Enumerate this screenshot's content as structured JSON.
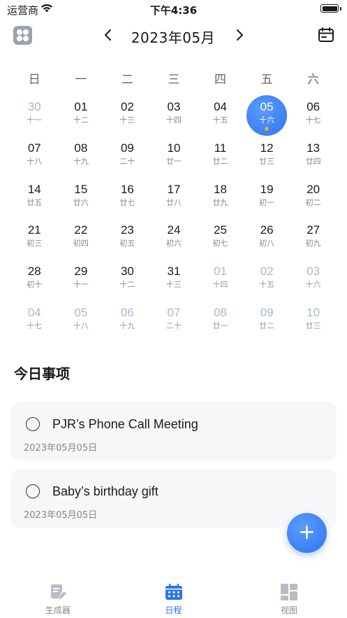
{
  "status_bar": {
    "carrier": "运营商",
    "time": "下午4:36"
  },
  "header": {
    "prev_icon": "chevron-left-icon",
    "next_icon": "chevron-right-icon",
    "month_title": "2023年05月",
    "calendar_icon": "calendar-icon"
  },
  "weekdays": [
    "日",
    "一",
    "二",
    "三",
    "四",
    "五",
    "六"
  ],
  "calendar": {
    "selected_day": "05",
    "days": [
      {
        "num": "30",
        "lunar": "十一",
        "other": true
      },
      {
        "num": "01",
        "lunar": "十二",
        "other": false
      },
      {
        "num": "02",
        "lunar": "十三",
        "other": false
      },
      {
        "num": "03",
        "lunar": "十四",
        "other": false
      },
      {
        "num": "04",
        "lunar": "十五",
        "other": false
      },
      {
        "num": "05",
        "lunar": "十六",
        "other": false,
        "selected": true,
        "has_event": true
      },
      {
        "num": "06",
        "lunar": "十七",
        "other": false
      },
      {
        "num": "07",
        "lunar": "十八",
        "other": false
      },
      {
        "num": "08",
        "lunar": "十九",
        "other": false
      },
      {
        "num": "09",
        "lunar": "二十",
        "other": false
      },
      {
        "num": "10",
        "lunar": "廿一",
        "other": false
      },
      {
        "num": "11",
        "lunar": "廿二",
        "other": false
      },
      {
        "num": "12",
        "lunar": "廿三",
        "other": false
      },
      {
        "num": "13",
        "lunar": "廿四",
        "other": false
      },
      {
        "num": "14",
        "lunar": "廿五",
        "other": false
      },
      {
        "num": "15",
        "lunar": "廿六",
        "other": false
      },
      {
        "num": "16",
        "lunar": "廿七",
        "other": false
      },
      {
        "num": "17",
        "lunar": "廿八",
        "other": false
      },
      {
        "num": "18",
        "lunar": "廿九",
        "other": false
      },
      {
        "num": "19",
        "lunar": "初一",
        "other": false
      },
      {
        "num": "20",
        "lunar": "初二",
        "other": false
      },
      {
        "num": "21",
        "lunar": "初三",
        "other": false
      },
      {
        "num": "22",
        "lunar": "初四",
        "other": false
      },
      {
        "num": "23",
        "lunar": "初五",
        "other": false
      },
      {
        "num": "24",
        "lunar": "初六",
        "other": false
      },
      {
        "num": "25",
        "lunar": "初七",
        "other": false
      },
      {
        "num": "26",
        "lunar": "初八",
        "other": false
      },
      {
        "num": "27",
        "lunar": "初九",
        "other": false
      },
      {
        "num": "28",
        "lunar": "初十",
        "other": false
      },
      {
        "num": "29",
        "lunar": "十一",
        "other": false
      },
      {
        "num": "30",
        "lunar": "十二",
        "other": false
      },
      {
        "num": "31",
        "lunar": "十三",
        "other": false
      },
      {
        "num": "01",
        "lunar": "十四",
        "other": true
      },
      {
        "num": "02",
        "lunar": "十五",
        "other": true
      },
      {
        "num": "03",
        "lunar": "十六",
        "other": true
      },
      {
        "num": "04",
        "lunar": "十七",
        "other": true
      },
      {
        "num": "05",
        "lunar": "十八",
        "other": true
      },
      {
        "num": "06",
        "lunar": "十九",
        "other": true
      },
      {
        "num": "07",
        "lunar": "二十",
        "other": true
      },
      {
        "num": "08",
        "lunar": "廿一",
        "other": true
      },
      {
        "num": "09",
        "lunar": "廿二",
        "other": true
      },
      {
        "num": "10",
        "lunar": "廿三",
        "other": true
      }
    ]
  },
  "today": {
    "title": "今日事项",
    "tasks": [
      {
        "title": "PJR’s Phone Call Meeting",
        "date": "2023年05月05日",
        "done": false
      },
      {
        "title": "Baby’s birthday gift",
        "date": "2023年05月05日",
        "done": false
      }
    ]
  },
  "fab": {
    "label": "+",
    "icon": "add-icon"
  },
  "tabbar": {
    "tabs": [
      {
        "label": "生成器",
        "icon": "document-edit-icon",
        "active": false
      },
      {
        "label": "日程",
        "icon": "calendar-icon",
        "active": true
      },
      {
        "label": "视图",
        "icon": "grid-view-icon",
        "active": false
      }
    ]
  },
  "colors": {
    "accent": "#2f73f0",
    "event_dot": "#f3a63b",
    "muted_day": "#a9b7cc",
    "card_bg": "#f6f7f9"
  }
}
